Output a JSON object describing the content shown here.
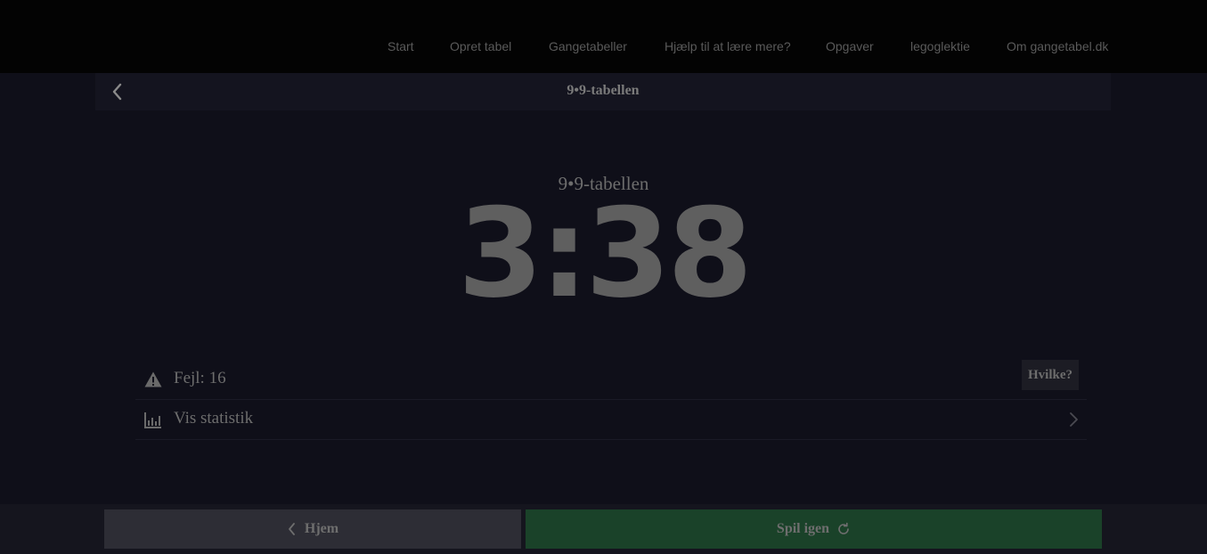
{
  "nav": {
    "items": [
      "Start",
      "Opret tabel",
      "Gangetabeller",
      "Hjælp til at lære mere?",
      "Opgaver",
      "legoglektie",
      "Om gangetabel.dk"
    ]
  },
  "header": {
    "title": "9•9-tabellen",
    "back_icon": "chevron-left-icon"
  },
  "result": {
    "label": "9•9-tabellen",
    "time": "3:38"
  },
  "errors": {
    "label": "Fejl: 16",
    "icon": "warning-icon",
    "button_label": "Hvilke?"
  },
  "stats": {
    "label": "Vis statistik",
    "icon": "bar-chart-icon"
  },
  "footer": {
    "home_label": "Hjem",
    "again_label": "Spil igen",
    "again_color": "#1a4229",
    "home_color": "#2d2d35"
  }
}
